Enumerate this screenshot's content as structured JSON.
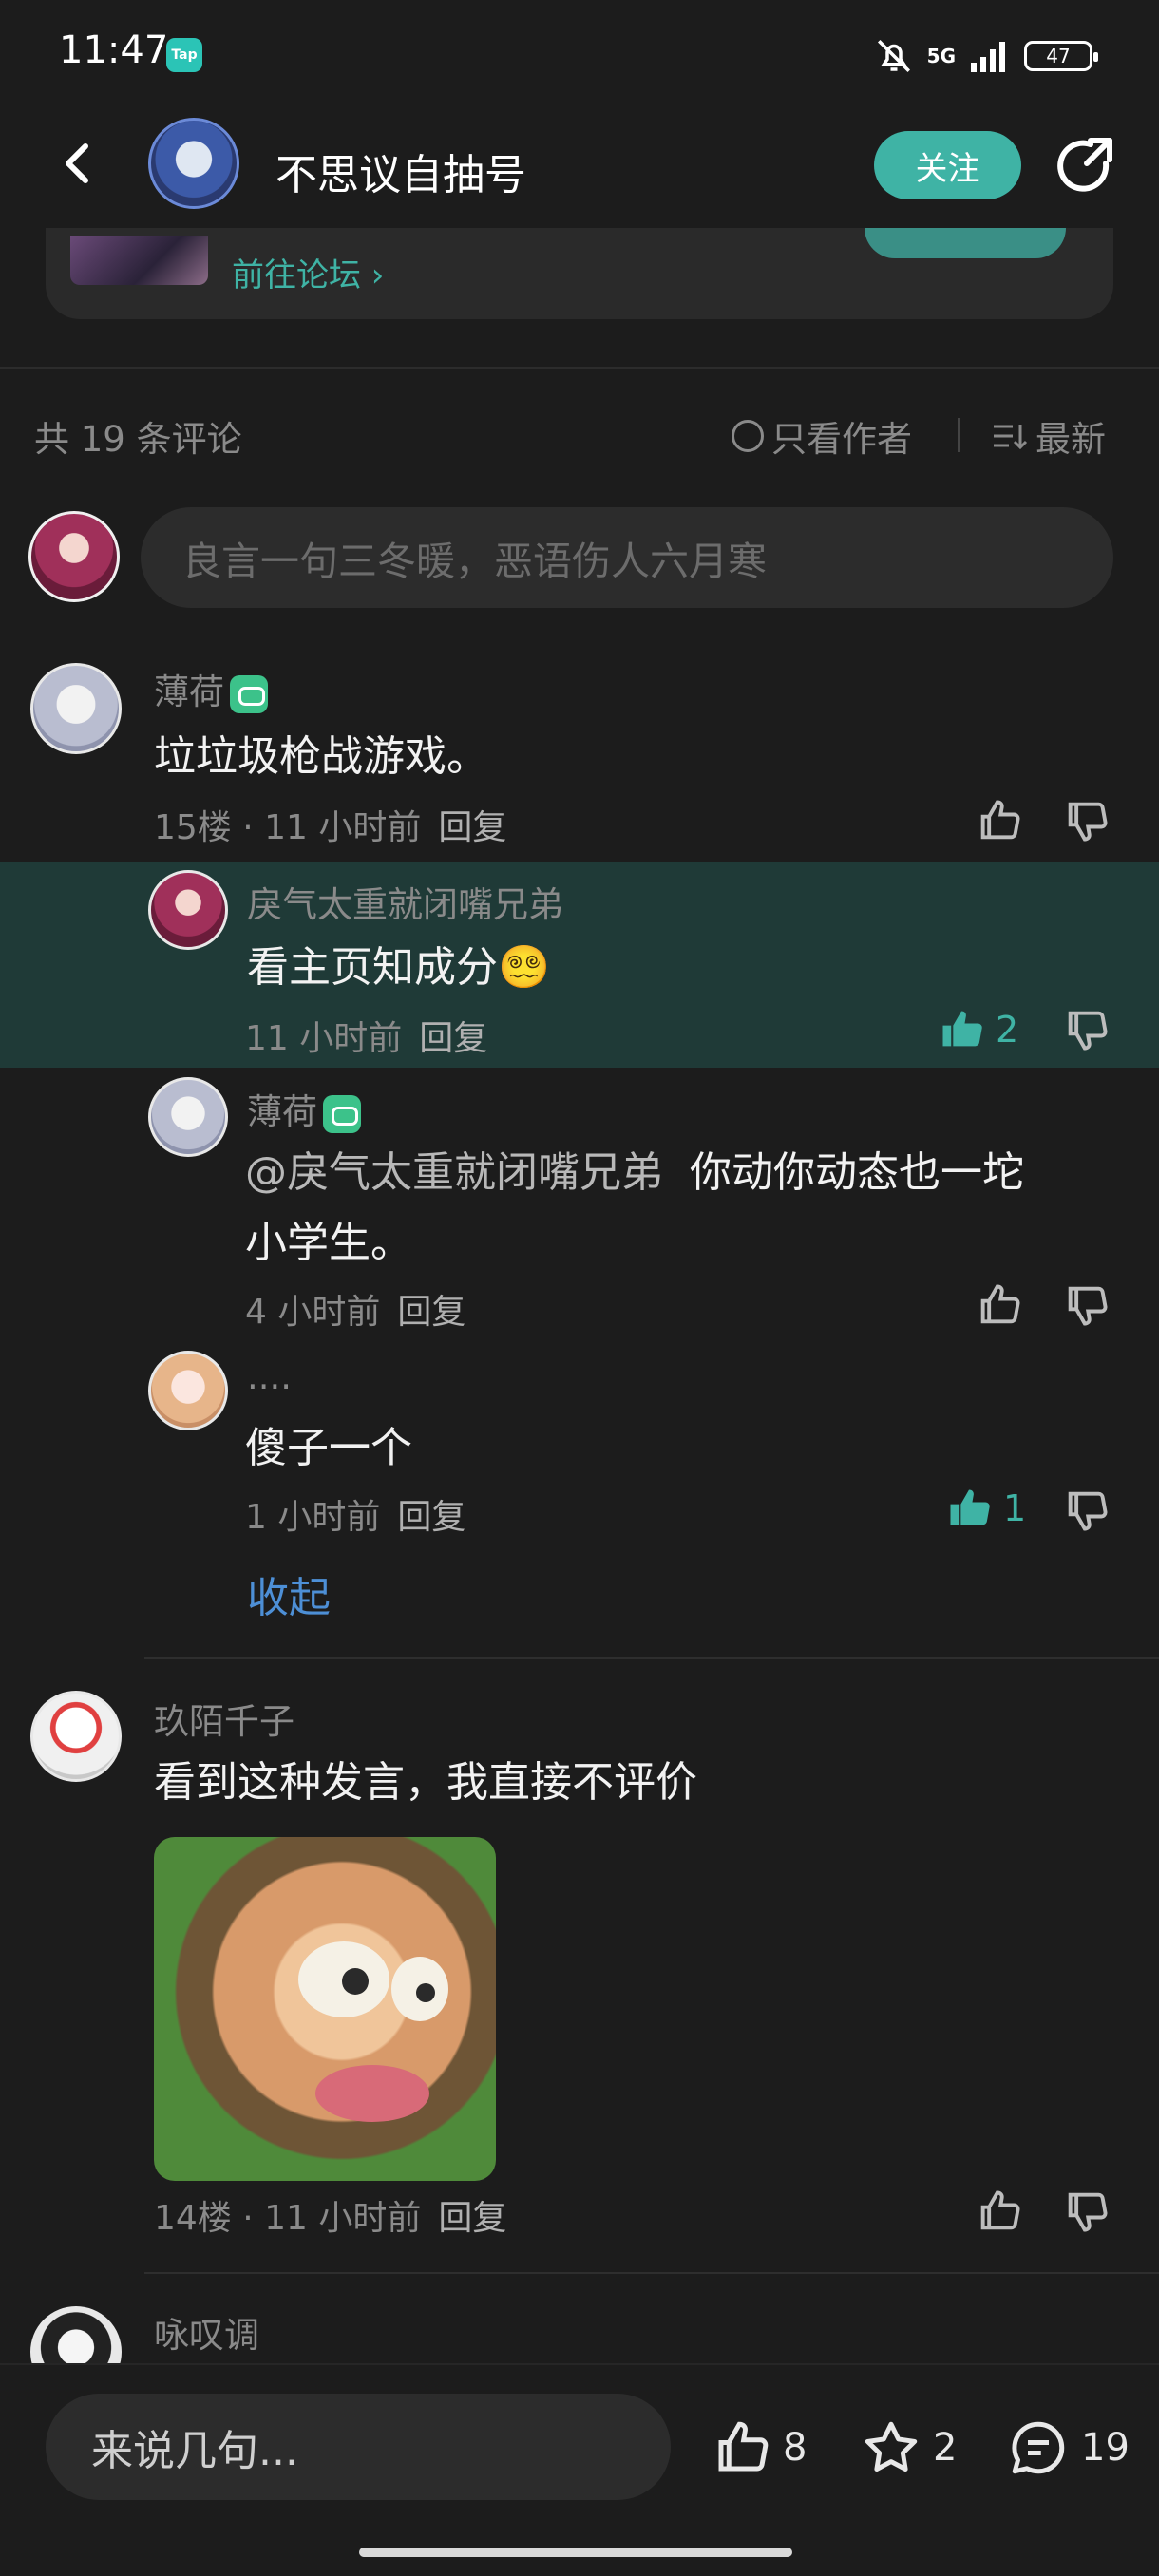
{
  "status_bar": {
    "time": "11:47",
    "app_badge": "Tap",
    "network": "5G",
    "battery": "47"
  },
  "header": {
    "title": "不思议自抽号",
    "follow_label": "关注"
  },
  "forum": {
    "link_label": "前往论坛 ›"
  },
  "comments_header": {
    "count_label": "共 19 条评论",
    "only_author_label": "只看作者",
    "sort_label": "最新"
  },
  "comment_input": {
    "placeholder": "良言一句三冬暖，恶语伤人六月寒"
  },
  "comments": [
    {
      "user": "薄荷",
      "text": "垃垃圾枪战游戏。",
      "floor": "15楼",
      "time": "11 小时前",
      "reply_label": "回复",
      "replies": [
        {
          "user": "戾气太重就闭嘴兄弟",
          "text": "看主页知成分😵‍💫",
          "time": "11 小时前",
          "reply_label": "回复",
          "likes": "2"
        },
        {
          "user": "薄荷",
          "mention": "@戾气太重就闭嘴兄弟",
          "text_line1": "你动你动态也一坨",
          "text_line2": "小学生。",
          "time": "4 小时前",
          "reply_label": "回复"
        },
        {
          "user": "....",
          "text": "傻子一个",
          "time": "1 小时前",
          "reply_label": "回复",
          "likes": "1"
        }
      ],
      "collapse_label": "收起"
    },
    {
      "user": "玖陌千子",
      "text": "看到这种发言，我直接不评价",
      "floor": "14楼",
      "time": "11 小时前",
      "reply_label": "回复"
    },
    {
      "user": "咏叹调"
    }
  ],
  "bottom_bar": {
    "input_placeholder": "来说几句...",
    "likes": "8",
    "stars": "2",
    "comments": "19"
  },
  "colors": {
    "accent": "#3fb3a5",
    "link": "#4d8fd6",
    "background": "#1c1c1c",
    "highlight": "#1f3a37"
  }
}
